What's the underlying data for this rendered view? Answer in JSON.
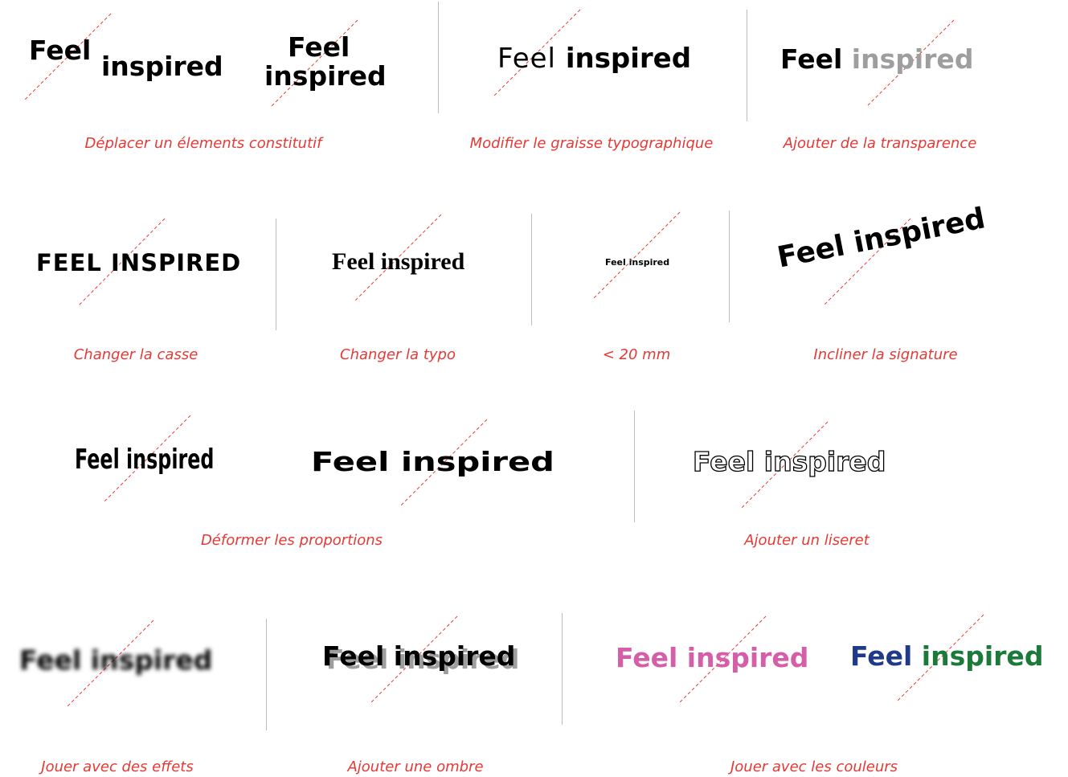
{
  "logo": {
    "feel": "Feel",
    "inspired": "inspired",
    "full": "Feel inspired",
    "full_upper": "FEEL INSPIRED"
  },
  "captions": {
    "move": "Déplacer un élements constitutif",
    "weight": "Modifier le graisse typographique",
    "transparency": "Ajouter de la transparence",
    "case": "Changer la casse",
    "typo": "Changer la typo",
    "size": "< 20 mm",
    "tilt": "Incliner la signature",
    "proportions": "Déformer les proportions",
    "outline": "Ajouter un liseret",
    "effects": "Jouer avec des effets",
    "shadow": "Ajouter une ombre",
    "colors": "Jouer avec les couleurs"
  },
  "colors": {
    "caption": "#e53935",
    "guide": "#e53935",
    "divider": "#bdbdbd",
    "transparent_word": "#9e9e9e",
    "pink": "#d45fa8",
    "navy": "#1f3a8a",
    "green": "#1b7a3a",
    "shadow": "#9e9e9e"
  },
  "icons": {
    "guide": "dashed-diagonal-guide"
  }
}
